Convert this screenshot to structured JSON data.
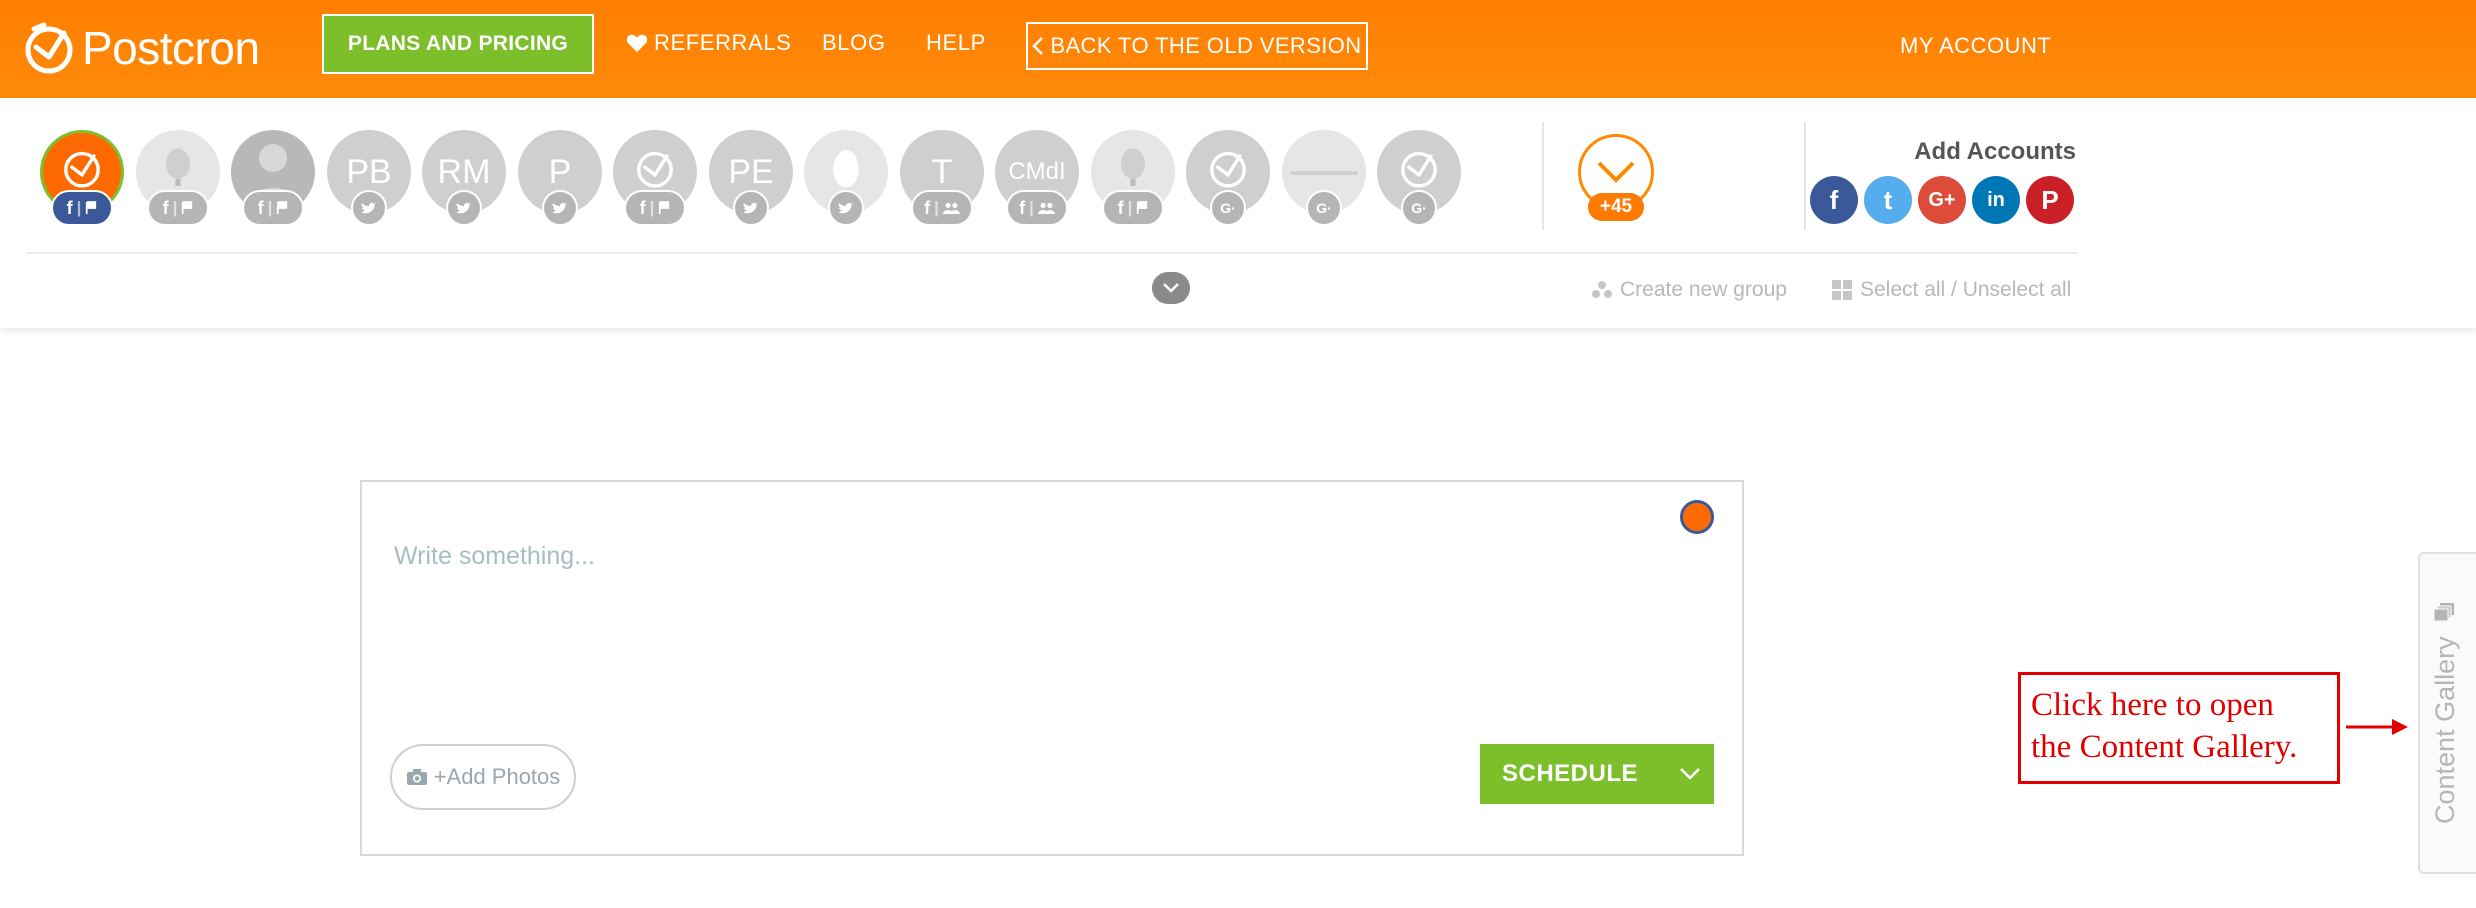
{
  "topbar": {
    "brand": "Postcron",
    "plans_button": "PLANS AND PRICING",
    "referrals": "REFERRALS",
    "blog": "BLOG",
    "help": "HELP",
    "back_button": "BACK TO THE OLD VERSION",
    "my_account": "MY ACCOUNT",
    "colors": {
      "bar": "#ff7f00",
      "plans": "#7dbf2a"
    }
  },
  "accounts": {
    "items": [
      {
        "label": "",
        "badge": "f|flag",
        "icon": "postcron-logo",
        "state": "active"
      },
      {
        "label": "",
        "badge": "f|flag",
        "icon": "balloon-photo",
        "state": "inactive"
      },
      {
        "label": "",
        "badge": "f|flag",
        "icon": "person-photo",
        "state": "inactive"
      },
      {
        "label": "PB",
        "badge": "twitter",
        "icon": "initials",
        "state": "inactive"
      },
      {
        "label": "RM",
        "badge": "twitter",
        "icon": "initials",
        "state": "inactive"
      },
      {
        "label": "P",
        "badge": "twitter",
        "icon": "initials",
        "state": "inactive"
      },
      {
        "label": "",
        "badge": "f|flag",
        "icon": "postcron-logo",
        "state": "inactive"
      },
      {
        "label": "PE",
        "badge": "twitter",
        "icon": "initials",
        "state": "inactive"
      },
      {
        "label": "",
        "badge": "twitter",
        "icon": "egg",
        "state": "inactive"
      },
      {
        "label": "T",
        "badge": "f|group",
        "icon": "initials",
        "state": "inactive"
      },
      {
        "label": "CMdI",
        "badge": "f|group",
        "icon": "initials",
        "state": "inactive"
      },
      {
        "label": "",
        "badge": "f|flag",
        "icon": "balloon-photo",
        "state": "inactive"
      },
      {
        "label": "",
        "badge": "google-plus",
        "icon": "postcron-logo",
        "state": "inactive"
      },
      {
        "label": "",
        "badge": "google-plus",
        "icon": "postcron-wordmark",
        "state": "inactive"
      },
      {
        "label": "",
        "badge": "google-plus",
        "icon": "postcron-logo",
        "state": "inactive"
      }
    ],
    "more_count": "+45",
    "add_accounts_title": "Add Accounts",
    "networks": [
      {
        "name": "facebook",
        "glyph": "f",
        "color": "#3b5998"
      },
      {
        "name": "twitter",
        "glyph": "t",
        "color": "#55acee"
      },
      {
        "name": "google-plus",
        "glyph": "G+",
        "color": "#dd4b39"
      },
      {
        "name": "linkedin",
        "glyph": "in",
        "color": "#0077b5"
      },
      {
        "name": "pinterest",
        "glyph": "P",
        "color": "#cb2027"
      }
    ],
    "create_group": "Create new group",
    "select_all": "Select all / Unselect all"
  },
  "composer": {
    "placeholder": "Write something...",
    "add_photos": "+Add Photos",
    "schedule": "SCHEDULE"
  },
  "annotation": {
    "line1": "Click here to open",
    "line2": "the Content Gallery."
  },
  "gallery_tab": {
    "label": "Content Gallery"
  }
}
